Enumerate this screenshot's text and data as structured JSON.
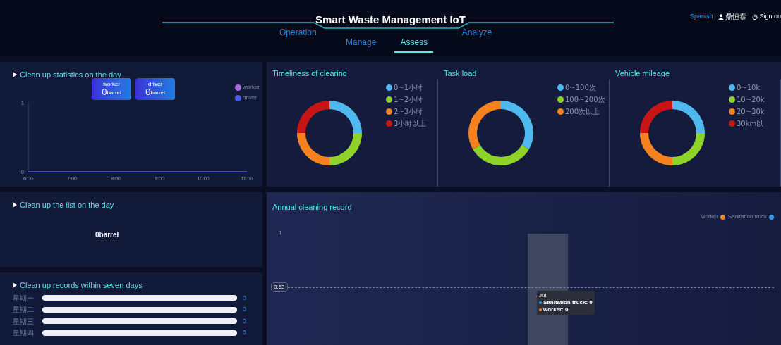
{
  "header": {
    "title": "Smart Waste Management IoT",
    "nav": [
      {
        "label": "Operation",
        "selected": false
      },
      {
        "label": "Manage",
        "selected": false
      },
      {
        "label": "Assess",
        "selected": true
      },
      {
        "label": "Analyze",
        "selected": false
      }
    ],
    "language": "Spanish",
    "user": "鼎恒泰",
    "sign_out": "Sign ou"
  },
  "stats_panel": {
    "title": "Clean up statistics on the day",
    "cards": [
      {
        "label": "worker",
        "value": "0",
        "unit": "barrel"
      },
      {
        "label": "driver",
        "value": "0",
        "unit": "barrel"
      }
    ],
    "chart_data": {
      "type": "line",
      "x": [
        "6:00",
        "7:00",
        "8:00",
        "9:00",
        "10:00",
        "11:00"
      ],
      "yticks": [
        0,
        1
      ],
      "ylim": [
        0,
        1
      ],
      "series": [
        {
          "name": "worker",
          "color": "#b06ae0",
          "values": [
            null,
            null,
            null,
            null,
            null,
            null
          ]
        },
        {
          "name": "driver",
          "color": "#4a5cf0",
          "values": [
            0,
            0,
            0,
            0,
            0,
            0
          ]
        }
      ]
    }
  },
  "donuts": [
    {
      "title": "Timeliness of clearing",
      "legend": [
        {
          "label": "0~1小时",
          "color": "#4fb8ef"
        },
        {
          "label": "1~2小时",
          "color": "#8fd32a"
        },
        {
          "label": "2~3小时",
          "color": "#f5821f"
        },
        {
          "label": "3小时以上",
          "color": "#c81414"
        }
      ]
    },
    {
      "title": "Task load",
      "legend": [
        {
          "label": "0~100次",
          "color": "#4fb8ef"
        },
        {
          "label": "100~200次",
          "color": "#8fd32a"
        },
        {
          "label": "200次以上",
          "color": "#f5821f"
        }
      ]
    },
    {
      "title": "Vehicle mileage",
      "legend": [
        {
          "label": "0~10k",
          "color": "#4fb8ef"
        },
        {
          "label": "10~20k",
          "color": "#8fd32a"
        },
        {
          "label": "20~30k",
          "color": "#f5821f"
        },
        {
          "label": "30km以",
          "color": "#c81414"
        }
      ]
    }
  ],
  "list_panel": {
    "title": "Clean up the list on the day",
    "total": "0barrel"
  },
  "seven_days": {
    "title": "Clean up records within seven days",
    "rows": [
      {
        "day": "星期一",
        "level": 0,
        "value": "0"
      },
      {
        "day": "星期二",
        "level": 0,
        "value": "0"
      },
      {
        "day": "星期三",
        "level": 0,
        "value": "0"
      },
      {
        "day": "星期四",
        "level": 0,
        "value": "0"
      }
    ]
  },
  "annual": {
    "title": "Annual cleaning record",
    "legend": [
      {
        "label": "worker",
        "color": "#f5821f"
      },
      {
        "label": "Sanitation truck",
        "color": "#2f9cf0"
      }
    ],
    "y_tick": "1",
    "mark_line": "0.63",
    "tooltip": {
      "title": "Jul",
      "items": [
        {
          "label": "Sanitation truck: 0",
          "color": "#2f9cf0"
        },
        {
          "label": "worker: 0",
          "color": "#f5821f"
        }
      ]
    }
  }
}
